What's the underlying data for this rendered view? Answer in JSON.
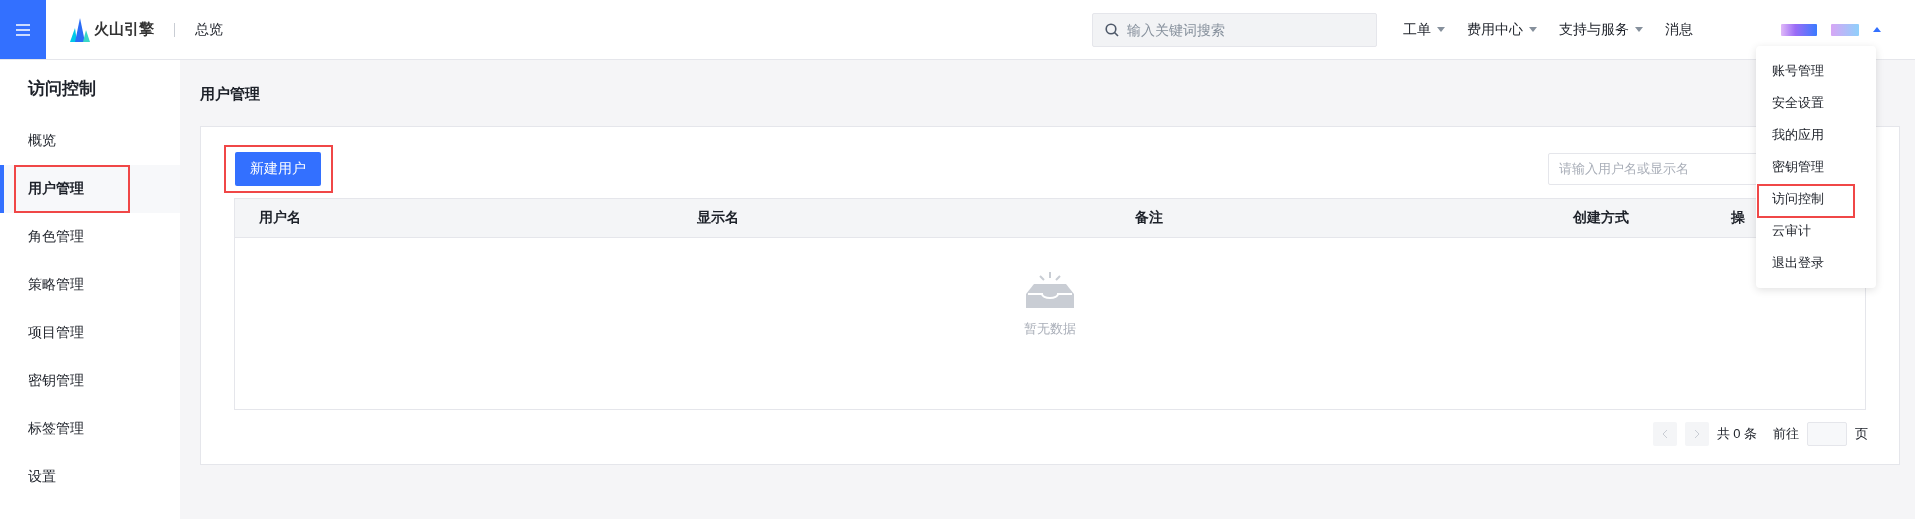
{
  "header": {
    "logo": "火山引擎",
    "breadcrumb": "总览",
    "search": {
      "placeholder": "输入关键词搜索"
    },
    "nav": [
      {
        "label": "工单",
        "dropdown": true
      },
      {
        "label": "费用中心",
        "dropdown": true
      },
      {
        "label": "支持与服务",
        "dropdown": true
      },
      {
        "label": "消息",
        "dropdown": false
      }
    ]
  },
  "sidebar": {
    "title": "访问控制",
    "items": [
      {
        "label": "概览",
        "selected": false,
        "highlighted": false
      },
      {
        "label": "用户管理",
        "selected": true,
        "highlighted": true
      },
      {
        "label": "角色管理",
        "selected": false,
        "highlighted": false
      },
      {
        "label": "策略管理",
        "selected": false,
        "highlighted": false
      },
      {
        "label": "项目管理",
        "selected": false,
        "highlighted": false
      },
      {
        "label": "密钥管理",
        "selected": false,
        "highlighted": false
      },
      {
        "label": "标签管理",
        "selected": false,
        "highlighted": false
      },
      {
        "label": "设置",
        "selected": false,
        "highlighted": false
      }
    ]
  },
  "page": {
    "title": "用户管理",
    "create_button": {
      "label": "新建用户",
      "highlighted": true
    },
    "filter": {
      "placeholder": "请输入用户名或显示名"
    },
    "table": {
      "columns": [
        "用户名",
        "显示名",
        "备注",
        "创建方式",
        "操"
      ],
      "empty_text": "暂无数据"
    },
    "pagination": {
      "total": "共 0 条",
      "goto": "前往",
      "page_suffix": "页"
    }
  },
  "user_menu": {
    "expanded": true,
    "items": [
      {
        "label": "账号管理",
        "highlighted": false
      },
      {
        "label": "安全设置",
        "highlighted": false
      },
      {
        "label": "我的应用",
        "highlighted": false
      },
      {
        "label": "密钥管理",
        "highlighted": false
      },
      {
        "label": "访问控制",
        "highlighted": true
      },
      {
        "label": "云审计",
        "highlighted": false
      },
      {
        "label": "退出登录",
        "highlighted": false
      }
    ]
  }
}
